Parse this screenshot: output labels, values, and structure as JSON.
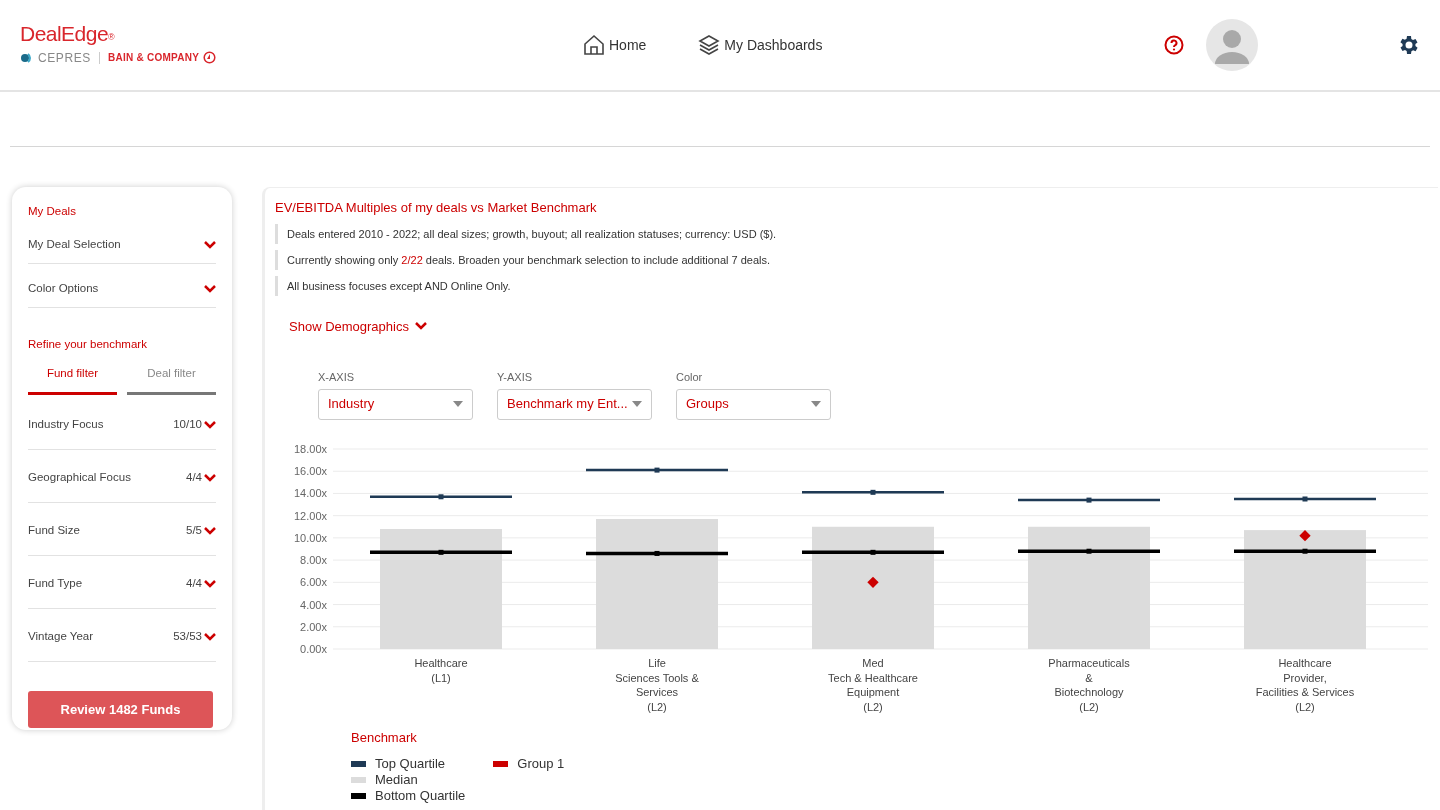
{
  "header": {
    "logo": {
      "brand": "DealEdge",
      "registered": "®",
      "partner_1": "CEPRES",
      "partner_2": "BAIN & COMPANY"
    },
    "nav": [
      {
        "label": "Home"
      },
      {
        "label": "My Dashboards"
      }
    ]
  },
  "sidebar": {
    "my_deals_heading": "My Deals",
    "deal_dropdowns": [
      "My Deal Selection",
      "Color Options"
    ],
    "refine_heading": "Refine your benchmark",
    "tabs": [
      {
        "label": "Fund filter",
        "selected": true
      },
      {
        "label": "Deal filter",
        "selected": false
      }
    ],
    "filters": [
      {
        "label": "Industry Focus",
        "count": "10/10"
      },
      {
        "label": "Geographical Focus",
        "count": "4/4"
      },
      {
        "label": "Fund Size",
        "count": "5/5"
      },
      {
        "label": "Fund Type",
        "count": "4/4"
      },
      {
        "label": "Vintage Year",
        "count": "53/53"
      }
    ],
    "review_button": "Review 1482 Funds"
  },
  "panel": {
    "title": "EV/EBITDA Multiples of my deals vs Market Benchmark",
    "notes": [
      "Deals entered 2010 - 2022; all deal sizes; growth, buyout; all realization statuses; currency: USD ($).",
      "Currently showing only **2/22** deals. Broaden your benchmark selection to include additional 7 deals.",
      "All business focuses except AND Online Only."
    ],
    "demographics_toggle": "Show Demographics",
    "selectors": [
      {
        "label": "X-AXIS",
        "value": "Industry"
      },
      {
        "label": "Y-AXIS",
        "value": "Benchmark my Ent..."
      },
      {
        "label": "Color",
        "value": "Groups"
      }
    ],
    "chart_data": {
      "type": "bar",
      "categories": [
        "Healthcare\n(L1)",
        "Life\nSciences Tools &\nServices\n(L2)",
        "Med\nTech & Healthcare\nEquipment\n(L2)",
        "Pharmaceuticals\n&\nBiotechnology\n(L2)",
        "Healthcare\nProvider,\nFacilities & Services\n(L2)"
      ],
      "series": [
        {
          "name": "Top Quartile",
          "type": "scatter",
          "marker": "square",
          "color": "#1f3a55",
          "values": [
            13.7,
            16.1,
            14.1,
            13.4,
            13.5
          ]
        },
        {
          "name": "Median",
          "type": "bar",
          "color": "#dcdcdc",
          "values": [
            10.8,
            11.7,
            11.0,
            11.0,
            10.7
          ]
        },
        {
          "name": "Bottom Quartile",
          "type": "scatter",
          "marker": "square",
          "color": "#000000",
          "values": [
            8.7,
            8.6,
            8.7,
            8.8,
            8.8
          ]
        },
        {
          "name": "Group 1",
          "type": "scatter",
          "marker": "diamond",
          "color": "#cc0000",
          "values": [
            null,
            null,
            6.0,
            null,
            10.2
          ]
        }
      ],
      "ylim": [
        0,
        18
      ],
      "grid": true,
      "yticks": [
        {
          "value": 0,
          "label": "0.00x"
        },
        {
          "value": 2,
          "label": "2.00x"
        },
        {
          "value": 4,
          "label": "4.00x"
        },
        {
          "value": 6,
          "label": "6.00x"
        },
        {
          "value": 8,
          "label": "8.00x"
        },
        {
          "value": 10,
          "label": "10.00x"
        },
        {
          "value": 12,
          "label": "12.00x"
        },
        {
          "value": 14,
          "label": "14.00x"
        },
        {
          "value": 16,
          "label": "16.00x"
        },
        {
          "value": 18,
          "label": "18.00x"
        }
      ]
    },
    "legend_title": "Benchmark"
  }
}
